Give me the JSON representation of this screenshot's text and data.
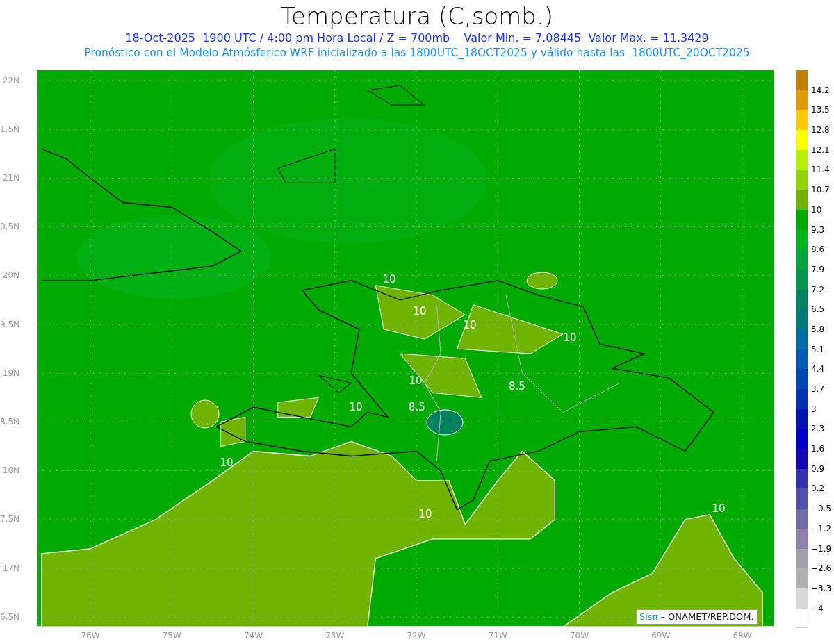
{
  "title": "Temperatura (C,somb.)",
  "subtitle_line_1": "18-Oct-2025  1900 UTC / 4:00 pm Hora Local / Z = 700mb    Valor Min. = 7.08445  Valor Max. = 11.3429",
  "subtitle_line_2": "Pronóstico con el Modelo Atmósferico WRF inicializado a las 1800UTC_18OCT2025 y válido hasta las  1800UTC_20OCT2025",
  "map": {
    "lat_labels": [
      "22N",
      "1.5N",
      "21N",
      "0.5N",
      "20N",
      "9.5N",
      "19N",
      "8.5N",
      "18N",
      "7.5N",
      "17N",
      "6.5N"
    ],
    "lon_labels": [
      "76W",
      "75W",
      "74W",
      "73W",
      "72W",
      "71W",
      "70W",
      "69W",
      "68W"
    ],
    "contour_labels": [
      "10",
      "10",
      "10",
      "10",
      "10",
      "10",
      "10",
      "10",
      "10",
      "8.5",
      "8.5"
    ],
    "credit": {
      "brand": "Sisπ",
      "text": "– ONAMET/REP.DOM."
    }
  },
  "colorbar": {
    "swatches": [
      {
        "color": "#bf7f00"
      },
      {
        "color": "#e09900"
      },
      {
        "color": "#ffc800"
      },
      {
        "color": "#ffff00"
      },
      {
        "color": "#b4f000"
      },
      {
        "color": "#8cd700"
      },
      {
        "color": "#6eb400"
      },
      {
        "color": "#00aa00"
      },
      {
        "color": "#00b41e"
      },
      {
        "color": "#00a53c"
      },
      {
        "color": "#00964b"
      },
      {
        "color": "#00825f"
      },
      {
        "color": "#007878"
      },
      {
        "color": "#006ea0"
      },
      {
        "color": "#005ab4"
      },
      {
        "color": "#0046b4"
      },
      {
        "color": "#0032b4"
      },
      {
        "color": "#0014b4"
      },
      {
        "color": "#0000c8"
      },
      {
        "color": "#1408b4"
      },
      {
        "color": "#3232aa"
      },
      {
        "color": "#5050aa"
      },
      {
        "color": "#6e6eaa"
      },
      {
        "color": "#9080b0"
      },
      {
        "color": "#a0a0a8"
      },
      {
        "color": "#b0b0b0"
      },
      {
        "color": "#d8d8d8"
      },
      {
        "color": "#ffffff"
      }
    ],
    "labels": [
      "14.2",
      "13.5",
      "12.8",
      "12.1",
      "11.4",
      "10.7",
      "10",
      "9.3",
      "8.6",
      "7.9",
      "7.2",
      "6.5",
      "5.8",
      "5.1",
      "4.4",
      "3.7",
      "3",
      "2.3",
      "1.6",
      "0.9",
      "0.2",
      "−0.5",
      "−1.2",
      "−1.9",
      "−2.6",
      "−3.3",
      "−4"
    ]
  }
}
